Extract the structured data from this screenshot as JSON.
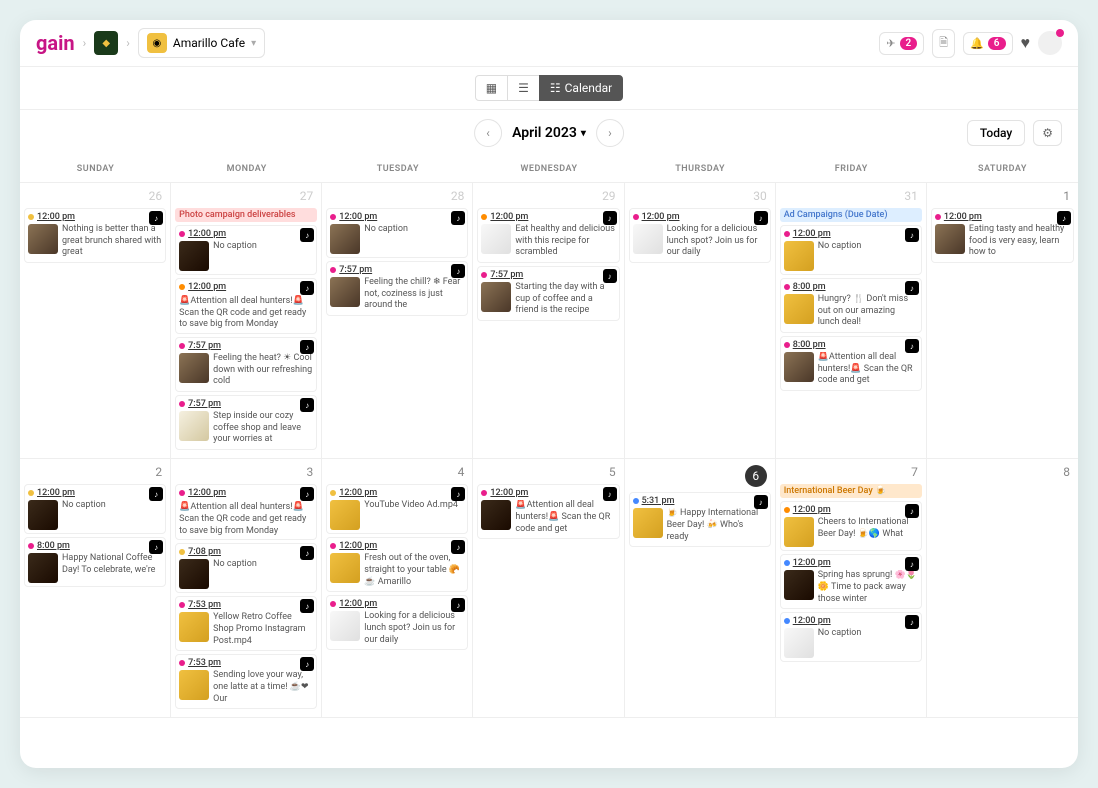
{
  "header": {
    "logo": "gain",
    "workspace": "Amarillo Cafe",
    "notif_paper": "2",
    "notif_bell": "6"
  },
  "viewbar": {
    "calendar": "Calendar"
  },
  "monthbar": {
    "month": "April 2023",
    "today": "Today"
  },
  "dow": [
    "SUNDAY",
    "MONDAY",
    "TUESDAY",
    "WEDNESDAY",
    "THURSDAY",
    "FRIDAY",
    "SATURDAY"
  ],
  "weeks": [
    {
      "days": [
        {
          "num": "26",
          "muted": true,
          "posts": [
            {
              "dot": "yellow",
              "time": "12:00 pm",
              "tt": true,
              "thumb": "",
              "cap": "Nothing is better than a great brunch shared with great"
            }
          ]
        },
        {
          "num": "27",
          "muted": true,
          "banner": {
            "cls": "pink",
            "text": "Photo campaign deliverables"
          },
          "posts": [
            {
              "dot": "pink",
              "time": "12:00 pm",
              "tt": true,
              "thumb": "dark",
              "cap": "No caption"
            },
            {
              "dot": "orange",
              "time": "12:00 pm",
              "tt": true,
              "textonly": true,
              "cap": "🚨Attention all deal hunters!🚨 Scan the QR code and get ready to save big from Monday"
            },
            {
              "dot": "pink",
              "time": "7:57 pm",
              "tt": true,
              "thumb": "",
              "cap": "Feeling the heat? ☀ Cool down with our refreshing cold"
            },
            {
              "dot": "pink",
              "time": "7:57 pm",
              "tt": true,
              "thumb": "cream",
              "cap": "Step inside our cozy coffee shop and leave your worries at"
            }
          ]
        },
        {
          "num": "28",
          "muted": true,
          "posts": [
            {
              "dot": "pink",
              "time": "12:00 pm",
              "tt": true,
              "thumb": "",
              "cap": "No caption"
            },
            {
              "dot": "pink",
              "time": "7:57 pm",
              "tt": true,
              "thumb": "",
              "cap": "Feeling the chill? ❄ Fear not, coziness is just around the"
            }
          ]
        },
        {
          "num": "29",
          "muted": true,
          "posts": [
            {
              "dot": "orange",
              "time": "12:00 pm",
              "tt": true,
              "thumb": "white",
              "cap": "Eat healthy and delicious with this recipe for scrambled"
            },
            {
              "dot": "pink",
              "time": "7:57 pm",
              "tt": true,
              "thumb": "",
              "cap": "Starting the day with a cup of coffee and a friend is the recipe"
            }
          ]
        },
        {
          "num": "30",
          "muted": true,
          "posts": [
            {
              "dot": "pink",
              "time": "12:00 pm",
              "tt": true,
              "thumb": "white",
              "cap": "Looking for a delicious lunch spot? Join us for our daily"
            }
          ]
        },
        {
          "num": "31",
          "muted": true,
          "banner": {
            "cls": "blue",
            "text": "Ad Campaigns (Due Date)"
          },
          "posts": [
            {
              "dot": "pink",
              "time": "12:00 pm",
              "tt": true,
              "thumb": "yellow",
              "cap": "No caption"
            },
            {
              "dot": "pink",
              "time": "8:00 pm",
              "tt": true,
              "thumb": "yellow",
              "cap": "Hungry? 🍴 Don't miss out on our amazing lunch deal!"
            },
            {
              "dot": "pink",
              "time": "8:00 pm",
              "tt": true,
              "thumb": "",
              "cap": "🚨Attention all deal hunters!🚨 Scan the QR code and get"
            }
          ]
        },
        {
          "num": "1",
          "posts": [
            {
              "dot": "pink",
              "time": "12:00 pm",
              "tt": true,
              "thumb": "",
              "cap": "Eating tasty and healthy food is very easy, learn how to"
            }
          ]
        }
      ]
    },
    {
      "days": [
        {
          "num": "2",
          "posts": [
            {
              "dot": "yellow",
              "time": "12:00 pm",
              "tt": true,
              "thumb": "dark",
              "cap": "No caption"
            },
            {
              "dot": "pink",
              "time": "8:00 pm",
              "tt": true,
              "thumb": "dark",
              "cap": "Happy National Coffee Day! To celebrate, we're"
            }
          ]
        },
        {
          "num": "3",
          "posts": [
            {
              "dot": "pink",
              "time": "12:00 pm",
              "tt": true,
              "textonly": true,
              "cap": "🚨Attention all deal hunters!🚨 Scan the QR code and get ready to save big from Monday"
            },
            {
              "dot": "yellow",
              "time": "7:08 pm",
              "tt": true,
              "thumb": "dark",
              "cap": "No caption"
            },
            {
              "dot": "pink",
              "time": "7:53 pm",
              "tt": true,
              "thumb": "yellow",
              "cap": "Yellow Retro Coffee Shop Promo Instagram Post.mp4"
            },
            {
              "dot": "pink",
              "time": "7:53 pm",
              "tt": true,
              "thumb": "yellow",
              "cap": "Sending love your way, one latte at a time! ☕❤ Our"
            }
          ]
        },
        {
          "num": "4",
          "posts": [
            {
              "dot": "yellow",
              "time": "12:00 pm",
              "tt": true,
              "thumb": "yellow",
              "cap": "YouTube Video Ad.mp4"
            },
            {
              "dot": "pink",
              "time": "12:00 pm",
              "tt": true,
              "thumb": "yellow",
              "cap": "Fresh out of the oven, straight to your table 🥐☕ Amarillo"
            },
            {
              "dot": "pink",
              "time": "12:00 pm",
              "tt": true,
              "thumb": "white",
              "cap": "Looking for a delicious lunch spot? Join us for our daily"
            }
          ]
        },
        {
          "num": "5",
          "posts": [
            {
              "dot": "pink",
              "time": "12:00 pm",
              "tt": true,
              "thumb": "dark",
              "cap": "🚨Attention all deal hunters!🚨 Scan the QR code and get"
            }
          ]
        },
        {
          "num": "6",
          "today": true,
          "posts": [
            {
              "dot": "blue",
              "time": "5:31 pm",
              "tt": true,
              "thumb": "yellow",
              "cap": "🍺 Happy International Beer Day! 🍻 Who's ready"
            }
          ]
        },
        {
          "num": "7",
          "banner": {
            "cls": "orange",
            "text": "International Beer Day 🍺"
          },
          "posts": [
            {
              "dot": "orange",
              "time": "12:00 pm",
              "tt": true,
              "thumb": "yellow",
              "cap": "Cheers to International Beer Day! 🍺🌎 What"
            },
            {
              "dot": "blue",
              "time": "12:00 pm",
              "tt": true,
              "thumb": "dark",
              "cap": "Spring has sprung! 🌸🌷🌼 Time to pack away those winter"
            },
            {
              "dot": "blue",
              "time": "12:00 pm",
              "tt": true,
              "thumb": "white",
              "cap": "No caption"
            }
          ]
        },
        {
          "num": "8",
          "posts": []
        }
      ]
    }
  ]
}
